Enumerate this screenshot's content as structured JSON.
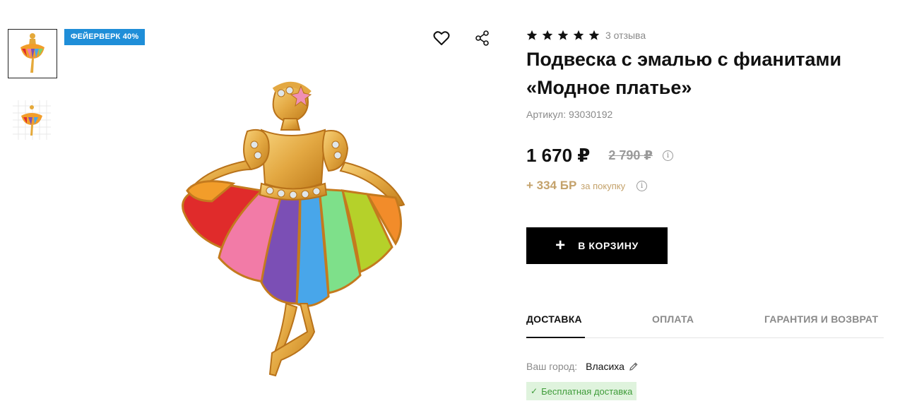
{
  "gallery": {
    "thumbnails": [
      {
        "name": "thumbnail-1",
        "icon": "ballerina-pendant-photo"
      },
      {
        "name": "thumbnail-2",
        "icon": "ballerina-pendant-size-grid"
      }
    ],
    "badge": "ФЕЙЕРВЕРК 40%",
    "favorite_icon": "heart-icon",
    "share_icon": "share-icon"
  },
  "product": {
    "rating": 5,
    "reviews": "3 отзыва",
    "title": "Подвеска с эмалью с фианитами «Модное платье»",
    "article_label": "Артикул:",
    "article_value": "93030192",
    "price": "1 670 ₽",
    "old_price": "2 790 ₽",
    "bonus_amount": "+ 334 БР",
    "bonus_text": "за покупку",
    "add_to_cart": "В КОРЗИНУ"
  },
  "tabs": [
    {
      "label": "ДОСТАВКА",
      "active": true
    },
    {
      "label": "ОПЛАТА",
      "active": false
    },
    {
      "label": "ГАРАНТИЯ И ВОЗВРАТ",
      "active": false
    }
  ],
  "delivery": {
    "city_label": "Ваш город:",
    "city_value": "Власиха",
    "free_delivery": "Бесплатная доставка"
  },
  "colors": {
    "badge": "#1f8ed8",
    "bonus": "#c4a26b",
    "button": "#000000",
    "free_delivery_bg": "#dff3dd",
    "free_delivery_text": "#3f9c3a"
  }
}
